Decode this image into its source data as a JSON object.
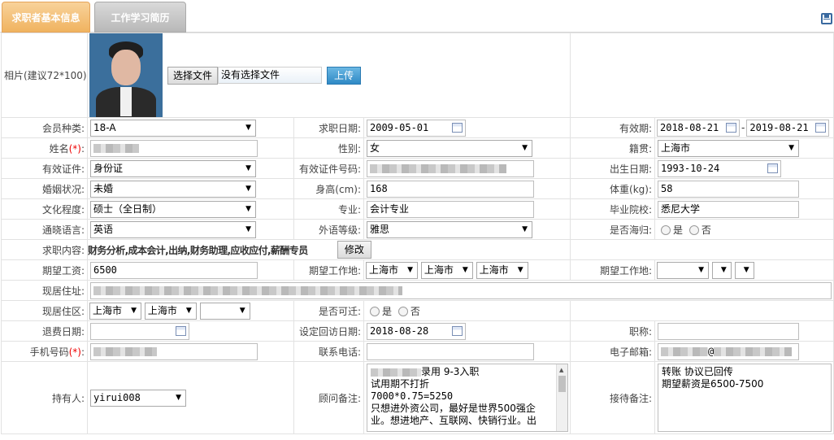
{
  "tabs": [
    "求职者基本信息",
    "工作学习简历"
  ],
  "photo": {
    "label": "相片(建议72*100):",
    "choose_btn": "选择文件",
    "no_file": "没有选择文件",
    "upload_btn": "上传"
  },
  "rows": {
    "member_type": {
      "label": "会员种类:",
      "value": "18-A"
    },
    "job_date": {
      "label": "求职日期:",
      "value": "2009-05-01"
    },
    "valid_period": {
      "label": "有效期:",
      "from": "2018-08-21",
      "sep": "-",
      "to": "2019-08-21"
    },
    "name": {
      "label": "姓名",
      "req": "(*)",
      "colon": ":"
    },
    "gender": {
      "label": "性别:",
      "value": "女"
    },
    "native": {
      "label": "籍贯:",
      "value": "上海市"
    },
    "id_type": {
      "label": "有效证件:",
      "value": "身份证"
    },
    "id_no": {
      "label": "有效证件号码:"
    },
    "birth": {
      "label": "出生日期:",
      "value": "1993-10-24"
    },
    "marital": {
      "label": "婚姻状况:",
      "value": "未婚"
    },
    "height": {
      "label": "身高(cm):",
      "value": "168"
    },
    "weight": {
      "label": "体重(kg):",
      "value": "58"
    },
    "education": {
      "label": "文化程度:",
      "value": "硕士（全日制）"
    },
    "major": {
      "label": "专业:",
      "value": "会计专业"
    },
    "school": {
      "label": "毕业院校:",
      "value": "悉尼大学"
    },
    "language": {
      "label": "通晓语言:",
      "value": "英语"
    },
    "lang_level": {
      "label": "外语等级:",
      "value": "雅思"
    },
    "returnee": {
      "label": "是否海归:",
      "yes": "是",
      "no": "否"
    },
    "job_content": {
      "label": "求职内容:",
      "value": "财务分析,成本会计,出纳,财务助理,应收应付,薪酬专员",
      "btn": "修改"
    },
    "salary": {
      "label": "期望工资:",
      "value": "6500"
    },
    "work_place": {
      "label": "期望工作地:",
      "a": "上海市",
      "b": "上海市",
      "c": "上海市"
    },
    "work_place2": {
      "label": "期望工作地:"
    },
    "address": {
      "label": "现居住址:"
    },
    "living_area": {
      "label": "现居住区:",
      "a": "上海市",
      "b": "上海市"
    },
    "relocate": {
      "label": "是否可迁:",
      "yes": "是",
      "no": "否"
    },
    "refund_date": {
      "label": "退费日期:"
    },
    "revisit_date": {
      "label": "设定回访日期:",
      "value": "2018-08-28"
    },
    "title": {
      "label": "职称:"
    },
    "mobile": {
      "label": "手机号码",
      "req": "(*)",
      "colon": ":"
    },
    "phone": {
      "label": "联系电话:"
    },
    "email": {
      "label": "电子邮箱:",
      "at": "@"
    },
    "holder": {
      "label": "持有人:",
      "value": "yirui008"
    },
    "advisor_note": {
      "label": "顾问备注:",
      "l1": "录用   9-3入职",
      "l2": "试用期不打折",
      "l3": "7000*0.75=5250",
      "l4": "只想进外资公司，最好是世界500强企",
      "l5": "业。想进地产、互联网、快销行业。出"
    },
    "reception_note": {
      "label": "接待备注:",
      "l1": "转账  协议已回传",
      "l2": "期望薪资是6500-7500"
    }
  }
}
